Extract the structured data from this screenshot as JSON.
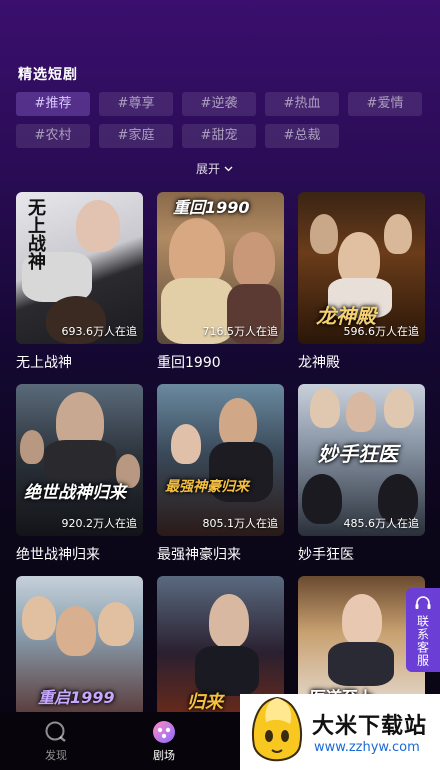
{
  "section": {
    "title": "精选短剧"
  },
  "tags": [
    "#推荐",
    "#尊享",
    "#逆袭",
    "#热血",
    "#爱情",
    "#农村",
    "#家庭",
    "#甜宠",
    "#总裁"
  ],
  "expand_label": "展开",
  "dramas": [
    {
      "title": "无上战神",
      "followers": "693.6万人在追",
      "poster_text": "无上战神"
    },
    {
      "title": "重回1990",
      "followers": "716.5万人在追",
      "poster_text": "重回1990"
    },
    {
      "title": "龙神殿",
      "followers": "596.6万人在追",
      "poster_text": "龙神殿"
    },
    {
      "title": "绝世战神归来",
      "followers": "920.2万人在追",
      "poster_text": "绝世战神归来"
    },
    {
      "title": "最强神豪归来",
      "followers": "805.1万人在追",
      "poster_text": "最强神豪归来"
    },
    {
      "title": "妙手狂医",
      "followers": "485.6万人在追",
      "poster_text": "妙手狂医"
    },
    {
      "title": "",
      "followers": "",
      "poster_text": "重启1999"
    },
    {
      "title": "",
      "followers": "",
      "poster_text": "归来"
    },
    {
      "title": "",
      "followers": "",
      "poster_text": "医道至上"
    }
  ],
  "float_service": {
    "label": "联系客服"
  },
  "tabbar": {
    "items": [
      {
        "label": "发现",
        "icon": "discover-icon",
        "active": false
      },
      {
        "label": "剧场",
        "icon": "theater-icon",
        "active": true
      }
    ]
  },
  "watermark": {
    "name": "大米下载站",
    "url": "www.zzhyw.com"
  },
  "colors": {
    "accent": "#6b3fd6",
    "tag_active_text": "#d8c6ff"
  }
}
